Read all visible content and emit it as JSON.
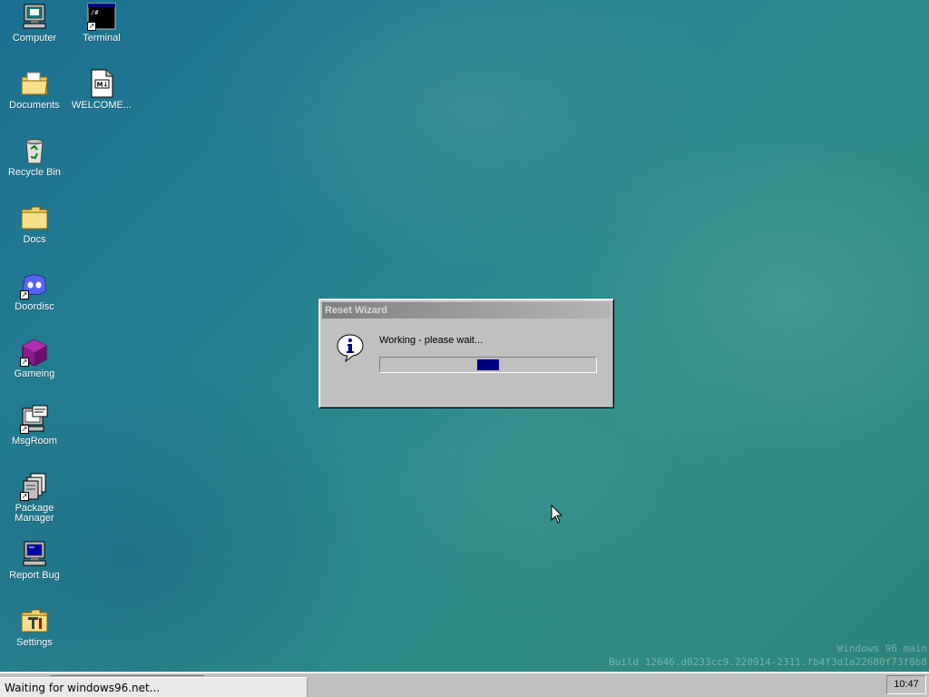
{
  "desktop": {
    "icons": [
      {
        "label": "Computer",
        "icon": "computer-icon"
      },
      {
        "label": "Terminal",
        "icon": "terminal-icon"
      },
      {
        "label": "Documents",
        "icon": "documents-folder-icon"
      },
      {
        "label": "WELCOME...",
        "icon": "markdown-file-icon"
      },
      {
        "label": "Recycle Bin",
        "icon": "recycle-bin-icon"
      },
      {
        "label": "Docs",
        "icon": "folder-icon"
      },
      {
        "label": "Doordisc",
        "icon": "doordisc-icon"
      },
      {
        "label": "Gameing",
        "icon": "game-cube-icon"
      },
      {
        "label": "MsgRoom",
        "icon": "msgroom-icon"
      },
      {
        "label": "Package Manager",
        "icon": "package-manager-icon"
      },
      {
        "label": "Report Bug",
        "icon": "report-bug-icon"
      },
      {
        "label": "Settings",
        "icon": "settings-icon"
      }
    ],
    "watermark": {
      "line1": "Windows 96 main",
      "line2": "Build 12646.d0233cc9.220914-2311.fb4f3d1a22680f73f8b8"
    }
  },
  "dialog": {
    "title": "Reset Wizard",
    "message": "Working - please wait...",
    "icon": "info-icon",
    "progress_accent": "#000080"
  },
  "taskbar": {
    "status_text": "Waiting for windows96.net...",
    "clock": "10:47"
  }
}
